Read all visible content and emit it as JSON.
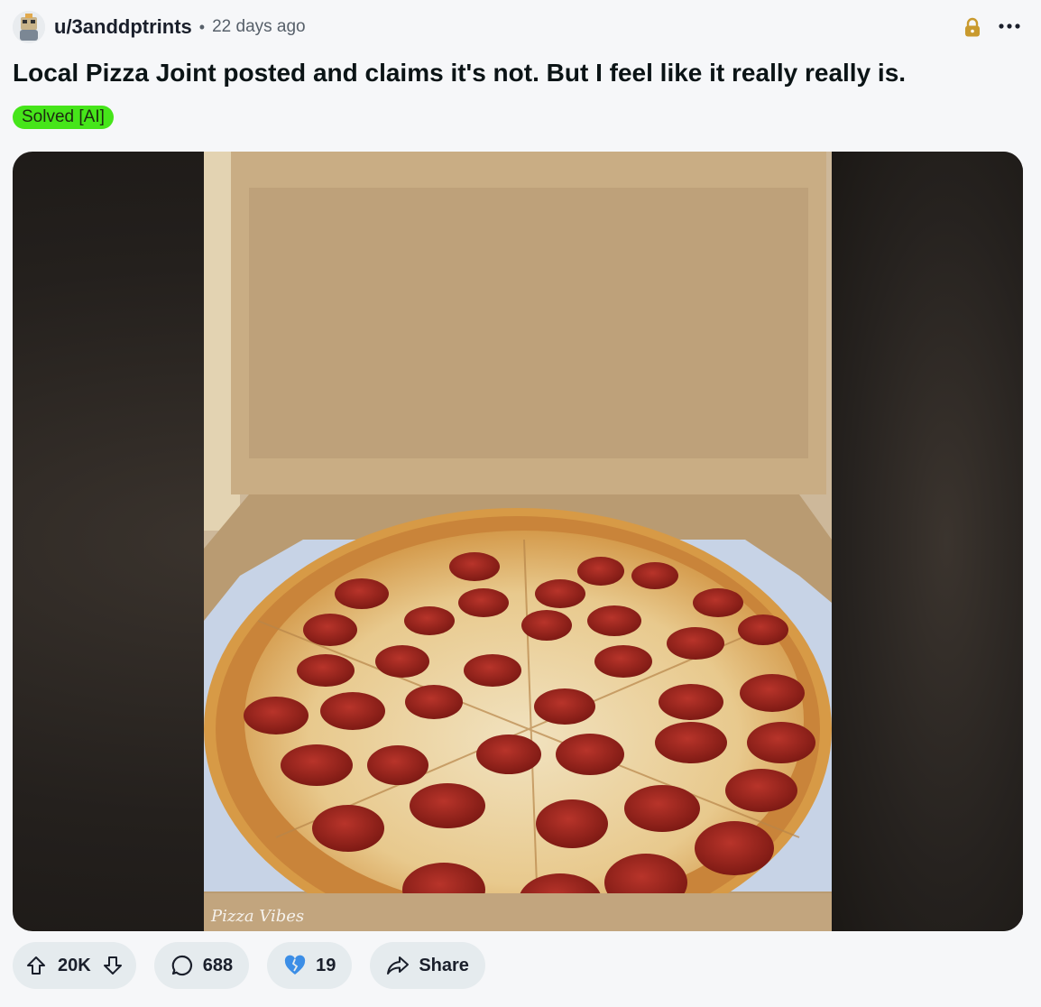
{
  "post": {
    "author": "u/3anddptrints",
    "separator": "•",
    "age": "22 days ago",
    "title": "Local Pizza Joint posted and claims it's not. But I feel like it really really is.",
    "flair": "Solved [AI]",
    "watermark": "Pizza Vibes"
  },
  "actions": {
    "votes": "20K",
    "comments": "688",
    "awards": "19",
    "share": "Share"
  },
  "colors": {
    "flair_bg": "#46e51a",
    "pill_bg": "#e5ebee",
    "lock": "#c99a2e",
    "award": "#3c8ee6"
  },
  "icons": [
    "avatar",
    "lock-icon",
    "more-icon",
    "upvote-icon",
    "downvote-icon",
    "comment-icon",
    "award-icon",
    "share-icon"
  ]
}
